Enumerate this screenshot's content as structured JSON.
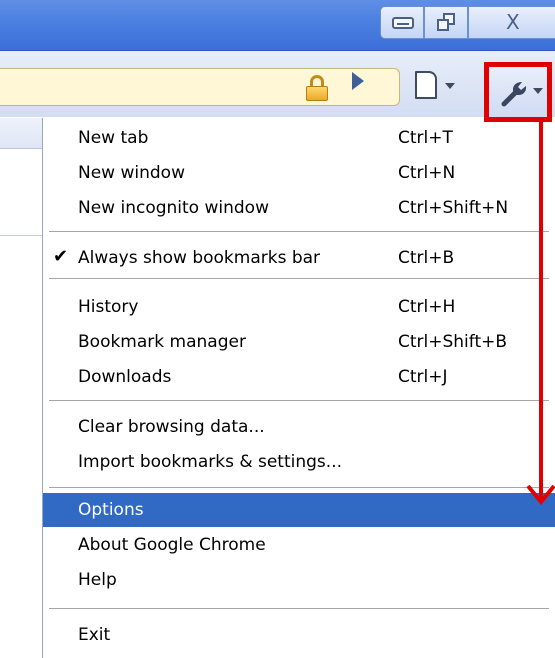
{
  "window": {
    "minimize_icon": "minimize-icon",
    "restore_icon": "restore-icon",
    "close_label": "X"
  },
  "toolbar": {
    "lock_icon": "lock-icon",
    "play_icon": "play-icon",
    "page_icon": "page-icon",
    "wrench_icon": "wrench-icon"
  },
  "menu": {
    "groups": [
      [
        {
          "label": "New tab",
          "shortcut": "Ctrl+T"
        },
        {
          "label": "New window",
          "shortcut": "Ctrl+N"
        },
        {
          "label": "New incognito window",
          "shortcut": "Ctrl+Shift+N"
        }
      ],
      [
        {
          "label": "Always show bookmarks bar",
          "shortcut": "Ctrl+B",
          "checked": true
        }
      ],
      [
        {
          "label": "History",
          "shortcut": "Ctrl+H"
        },
        {
          "label": "Bookmark manager",
          "shortcut": "Ctrl+Shift+B"
        },
        {
          "label": "Downloads",
          "shortcut": "Ctrl+J"
        }
      ],
      [
        {
          "label": "Clear browsing data...",
          "shortcut": ""
        },
        {
          "label": "Import bookmarks & settings...",
          "shortcut": ""
        }
      ],
      [
        {
          "label": "Options",
          "shortcut": "",
          "highlighted": true
        },
        {
          "label": "About Google Chrome",
          "shortcut": ""
        },
        {
          "label": "Help",
          "shortcut": ""
        }
      ],
      [
        {
          "label": "Exit",
          "shortcut": ""
        }
      ]
    ],
    "check_glyph": "✔"
  },
  "colors": {
    "highlight": "#316ac5",
    "annotation": "#e00000"
  }
}
